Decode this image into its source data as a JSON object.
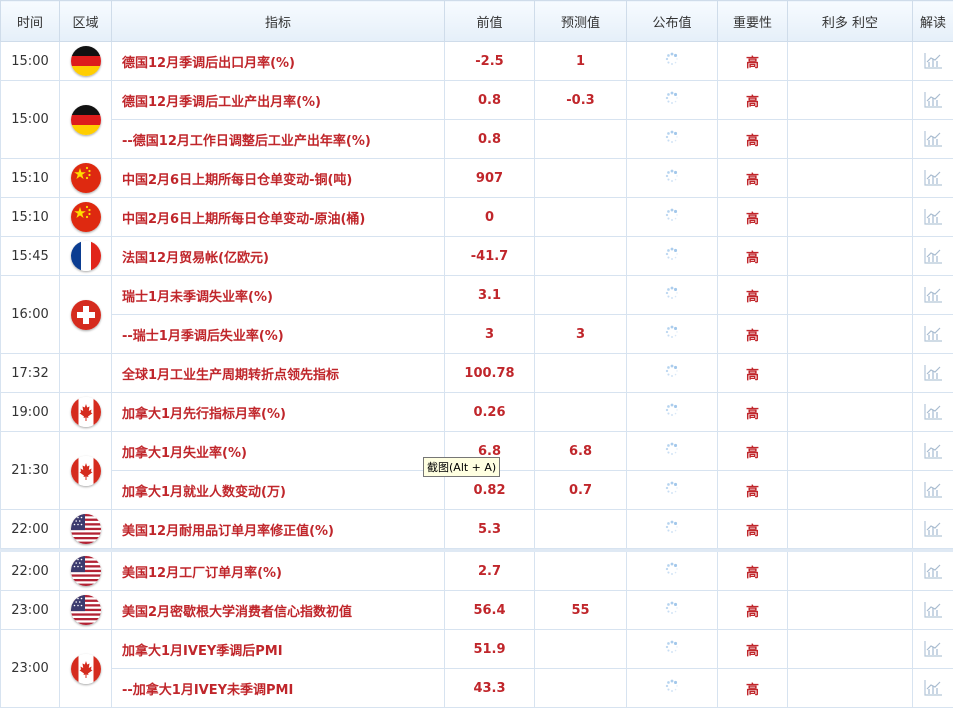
{
  "headers": [
    "时间",
    "区域",
    "指标",
    "前值",
    "预测值",
    "公布值",
    "重要性",
    "利多 利空",
    "解读"
  ],
  "rows": [
    {
      "time": "15:00",
      "flag": "germany",
      "indicator": "德国12月季调后出口月率(%)",
      "prev": "-2.5",
      "forecast": "1",
      "importance": "高"
    },
    {
      "time": "15:00",
      "flag": "germany",
      "indicator": "德国12月季调后工业产出月率(%)",
      "prev": "0.8",
      "forecast": "-0.3",
      "importance": "高"
    },
    {
      "indicator": "--德国12月工作日调整后工业产出年率(%)",
      "prev": "0.8",
      "forecast": "",
      "importance": "高"
    },
    {
      "time": "15:10",
      "flag": "china",
      "indicator": "中国2月6日上期所每日仓单变动-铜(吨)",
      "prev": "907",
      "forecast": "",
      "importance": "高"
    },
    {
      "time": "15:10",
      "flag": "china",
      "indicator": "中国2月6日上期所每日仓单变动-原油(桶)",
      "prev": "0",
      "forecast": "",
      "importance": "高"
    },
    {
      "time": "15:45",
      "flag": "france",
      "indicator": "法国12月贸易帐(亿欧元)",
      "prev": "-41.7",
      "forecast": "",
      "importance": "高"
    },
    {
      "time": "16:00",
      "flag": "switzerland",
      "indicator": "瑞士1月未季调失业率(%)",
      "prev": "3.1",
      "forecast": "",
      "importance": "高"
    },
    {
      "indicator": "--瑞士1月季调后失业率(%)",
      "prev": "3",
      "forecast": "3",
      "importance": "高"
    },
    {
      "time": "17:32",
      "flag": "",
      "indicator": "全球1月工业生产周期转折点领先指标",
      "prev": "100.78",
      "forecast": "",
      "importance": "高"
    },
    {
      "time": "19:00",
      "flag": "canada",
      "indicator": "加拿大1月先行指标月率(%)",
      "prev": "0.26",
      "forecast": "",
      "importance": "高"
    },
    {
      "time": "21:30",
      "flag": "canada",
      "indicator": "加拿大1月失业率(%)",
      "prev": "6.8",
      "forecast": "6.8",
      "importance": "高"
    },
    {
      "indicator": "加拿大1月就业人数变动(万)",
      "prev": "0.82",
      "forecast": "0.7",
      "importance": "高"
    },
    {
      "time": "22:00",
      "flag": "usa",
      "indicator": "美国12月耐用品订单月率修正值(%)",
      "prev": "5.3",
      "forecast": "",
      "importance": "高"
    },
    {
      "time": "22:00",
      "flag": "usa",
      "indicator": "美国12月工厂订单月率(%)",
      "prev": "2.7",
      "forecast": "",
      "importance": "高"
    },
    {
      "time": "23:00",
      "flag": "usa",
      "indicator": "美国2月密歇根大学消费者信心指数初值",
      "prev": "56.4",
      "forecast": "55",
      "importance": "高"
    },
    {
      "time": "23:00",
      "flag": "canada",
      "indicator": "加拿大1月IVEY季调后PMI",
      "prev": "51.9",
      "forecast": "",
      "importance": "高"
    },
    {
      "indicator": "--加拿大1月IVEY未季调PMI",
      "prev": "43.3",
      "forecast": "",
      "importance": "高"
    }
  ],
  "tooltip": "截图(Alt + A)",
  "colors": {
    "text_red": "#c0262b",
    "header_bg": "#e5eff9",
    "border": "#d7e3f0"
  }
}
